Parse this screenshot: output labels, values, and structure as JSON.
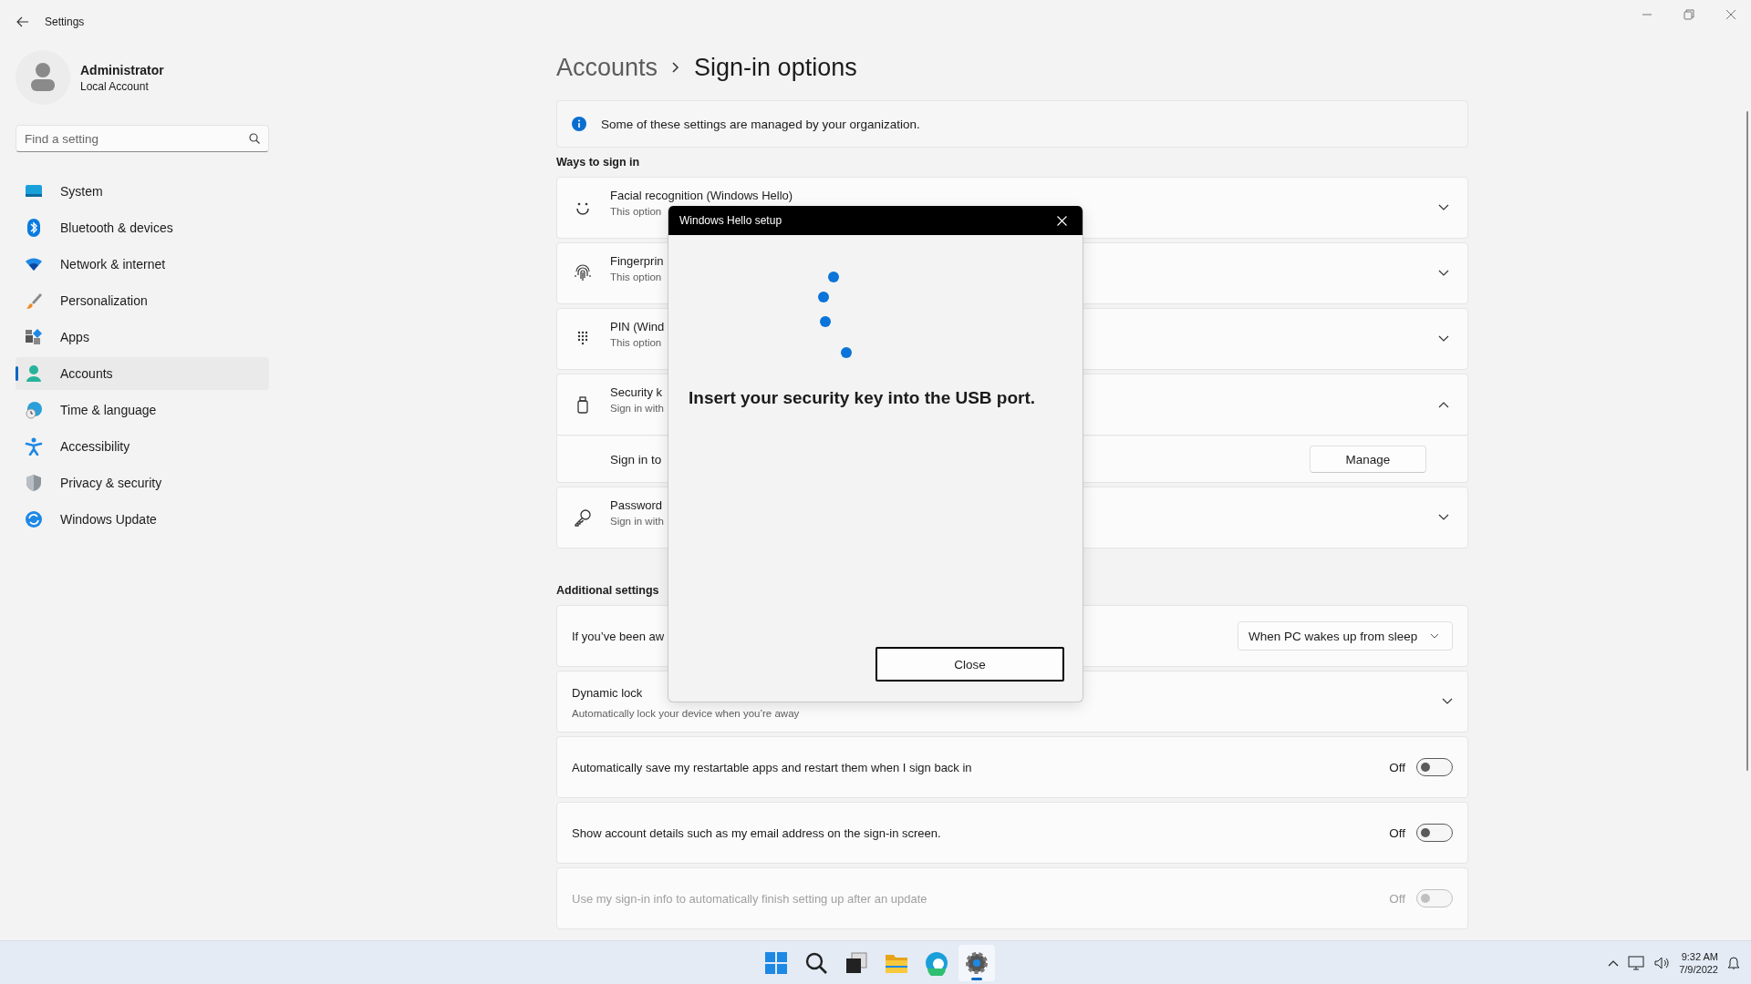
{
  "window": {
    "title": "Settings"
  },
  "account": {
    "name": "Administrator",
    "type": "Local Account"
  },
  "search": {
    "placeholder": "Find a setting"
  },
  "nav": [
    {
      "label": "System",
      "selected": false
    },
    {
      "label": "Bluetooth & devices",
      "selected": false
    },
    {
      "label": "Network & internet",
      "selected": false
    },
    {
      "label": "Personalization",
      "selected": false
    },
    {
      "label": "Apps",
      "selected": false
    },
    {
      "label": "Accounts",
      "selected": true
    },
    {
      "label": "Time & language",
      "selected": false
    },
    {
      "label": "Accessibility",
      "selected": false
    },
    {
      "label": "Privacy & security",
      "selected": false
    },
    {
      "label": "Windows Update",
      "selected": false
    }
  ],
  "breadcrumb": {
    "parent": "Accounts",
    "current": "Sign-in options"
  },
  "notice": "Some of these settings are managed by your organization.",
  "ways_heading": "Ways to sign in",
  "ways": [
    {
      "title": "Facial recognition (Windows Hello)",
      "subtitle": "This option",
      "expanded": false
    },
    {
      "title": "Fingerprin",
      "subtitle": "This option",
      "expanded": false
    },
    {
      "title": "PIN (Wind",
      "subtitle": "This option",
      "expanded": false
    },
    {
      "title": "Security k",
      "subtitle": "Sign in with",
      "expanded": true,
      "detail": {
        "label": "Sign in to",
        "button": "Manage"
      }
    },
    {
      "title": "Password",
      "subtitle": "Sign in with",
      "expanded": false
    }
  ],
  "additional_heading": "Additional settings",
  "additional": [
    {
      "kind": "dropdown",
      "title": "If you’ve been aw",
      "value": "When PC wakes up from sleep"
    },
    {
      "kind": "expander",
      "title": "Dynamic lock",
      "subtitle": "Automatically lock your device when you’re away",
      "expanded": false
    },
    {
      "kind": "toggle",
      "title": "Automatically save my restartable apps and restart them when I sign back in",
      "state": "Off",
      "on": false,
      "disabled": false
    },
    {
      "kind": "toggle",
      "title": "Show account details such as my email address on the sign-in screen.",
      "state": "Off",
      "on": false,
      "disabled": false
    },
    {
      "kind": "toggle",
      "title": "Use my sign-in info to automatically finish setting up after an update",
      "state": "Off",
      "on": false,
      "disabled": true
    }
  ],
  "dialog": {
    "title": "Windows Hello setup",
    "message": "Insert your security key into the USB port.",
    "button": "Close"
  },
  "taskbar": {
    "apps": [
      {
        "selected": false
      },
      {
        "selected": false
      },
      {
        "selected": false
      },
      {
        "selected": false
      },
      {
        "selected": false
      },
      {
        "selected": true
      }
    ],
    "time": "9:32 AM",
    "date": "7/9/2022"
  }
}
